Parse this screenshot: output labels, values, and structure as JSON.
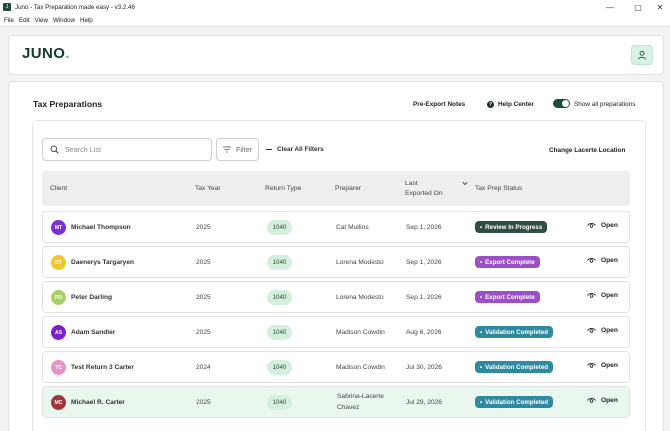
{
  "window": {
    "title": "Juno - Tax Preparation made easy - v3.2.46",
    "app_icon_text": "J",
    "minimize": "—",
    "maximize": "▢",
    "close": "✕"
  },
  "menu": [
    "File",
    "Edit",
    "View",
    "Window",
    "Help"
  ],
  "header": {
    "logo_text": "JUNO",
    "logo_dot": ".",
    "avatar_icon": "user-icon"
  },
  "page": {
    "title": "Tax Preparations",
    "pre_export_notes": "Pre-Export Notes",
    "help_center": "Help Center",
    "help_icon_glyph": "?",
    "show_all_label": "Show all preparations",
    "show_all_on": true
  },
  "toolbar": {
    "search_placeholder": "Search List",
    "filter_label": "Filter",
    "clear_filters_label": "Clear All Filters",
    "change_location_label": "Change Lacerte Location"
  },
  "table": {
    "columns": {
      "client": "Client",
      "tax_year": "Tax Year",
      "return_type": "Return Type",
      "preparer": "Preparer",
      "last_exported_line1": "Last",
      "last_exported_line2": "Exported On",
      "status": "Tax Prep Status"
    },
    "open_label": "Open",
    "rows": [
      {
        "initials": "MT",
        "avatar_color": "#7b2fd6",
        "client": "Michael Thompson",
        "tax_year": "2025",
        "return_type": "1040",
        "preparer": "Cat Mullins",
        "preparer_line2": "",
        "exported": "Sep 1, 2026",
        "status": "Review In Progress",
        "status_color": "#2f4f45"
      },
      {
        "initials": "DT",
        "avatar_color": "#f0c52e",
        "client": "Daenerys Targaryen",
        "tax_year": "2025",
        "return_type": "1040",
        "preparer": "Lorena Modesto",
        "preparer_line2": "",
        "exported": "Sep 1, 2026",
        "status": "Export Complete",
        "status_color": "#9b4fc9"
      },
      {
        "initials": "PD",
        "avatar_color": "#a9d16a",
        "client": "Peter Darling",
        "tax_year": "2025",
        "return_type": "1040",
        "preparer": "Lorena Modesto",
        "preparer_line2": "",
        "exported": "Sep 1, 2026",
        "status": "Export Complete",
        "status_color": "#9b4fc9"
      },
      {
        "initials": "AS",
        "avatar_color": "#7b1fc9",
        "client": "Adam Sandler",
        "tax_year": "2025",
        "return_type": "1040",
        "preparer": "Madison Cowdin",
        "preparer_line2": "",
        "exported": "Aug 6, 2026",
        "status": "Validation Completed",
        "status_color": "#2f8aa0"
      },
      {
        "initials": "TC",
        "avatar_color": "#e494c8",
        "client": "Test Return 3 Carter",
        "tax_year": "2024",
        "return_type": "1040",
        "preparer": "Madison Cowdin",
        "preparer_line2": "",
        "exported": "Jul 30, 2026",
        "status": "Validation Completed",
        "status_color": "#2f8aa0"
      },
      {
        "initials": "MC",
        "avatar_color": "#a0363d",
        "client": "Michael R. Carter",
        "tax_year": "2025",
        "return_type": "1040",
        "preparer": "Sabrina-Lacerte",
        "preparer_line2": "Chavez",
        "exported": "Jul 29, 2026",
        "status": "Validation Completed",
        "status_color": "#2f8aa0"
      }
    ]
  }
}
